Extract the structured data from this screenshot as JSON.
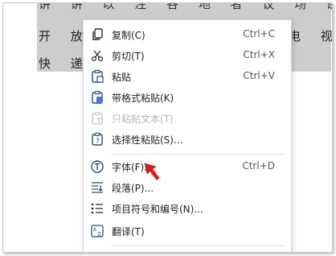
{
  "document": {
    "line_top": "讲 讲 以 注 各 地 者 议 场 讲 并 各 种 …",
    "line1_left": "开 放 广",
    "line1_right": "电 视 费",
    "line2_left": "快 递 费"
  },
  "context_menu": {
    "items": [
      {
        "label": "复制(C)",
        "shortcut": "Ctrl+C",
        "icon": "copy-icon"
      },
      {
        "label": "剪切(T)",
        "shortcut": "Ctrl+X",
        "icon": "scissors-icon"
      },
      {
        "label": "粘贴",
        "shortcut": "Ctrl+V",
        "icon": "paste-icon"
      },
      {
        "label": "带格式粘贴(K)",
        "shortcut": "",
        "icon": "paste-formatted-icon"
      },
      {
        "label": "只粘贴文本(T)",
        "shortcut": "",
        "icon": "paste-text-only-icon",
        "disabled": true
      },
      {
        "label": "选择性粘贴(S)...",
        "shortcut": "",
        "icon": "paste-special-icon"
      },
      {
        "label": "字体(F)...",
        "shortcut": "Ctrl+D",
        "icon": "font-icon"
      },
      {
        "label": "段落(P)...",
        "shortcut": "",
        "icon": "paragraph-icon"
      },
      {
        "label": "项目符号和编号(N)...",
        "shortcut": "",
        "icon": "bullets-numbering-icon"
      },
      {
        "label": "翻译(T)",
        "shortcut": "",
        "icon": "translate-icon"
      }
    ]
  },
  "colors": {
    "selection": "#cdcdcd",
    "arrow": "#e0161b",
    "icon": "#2b4c7e"
  }
}
